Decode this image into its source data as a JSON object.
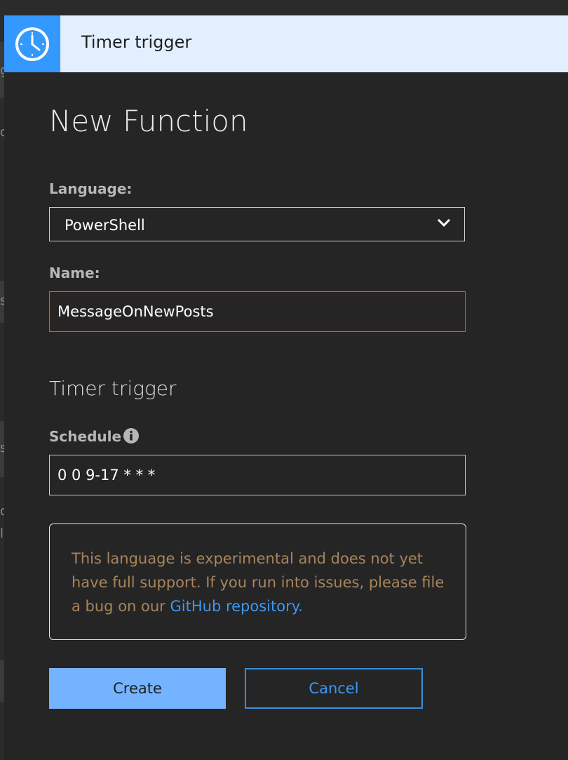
{
  "header": {
    "title": "Timer trigger",
    "icon": "clock-icon",
    "accent": "#3399ff"
  },
  "form": {
    "title": "New Function",
    "language": {
      "label": "Language:",
      "value": "PowerShell"
    },
    "name": {
      "label": "Name:",
      "value": "MessageOnNewPosts"
    },
    "trigger_section": "Timer trigger",
    "schedule": {
      "label": "Schedule",
      "value": "0 0 9-17 * * *",
      "info_icon": "info-icon"
    }
  },
  "notice": {
    "text": "This language is experimental and does not yet have full support. If you run into issues, please file a bug on our ",
    "link_text": "GitHub repository.",
    "color": "#a8855a",
    "link_color": "#3e98f4"
  },
  "buttons": {
    "create": "Create",
    "cancel": "Cancel"
  },
  "background_glyphs": [
    "g",
    "d",
    "s",
    "s",
    "d",
    "l"
  ]
}
